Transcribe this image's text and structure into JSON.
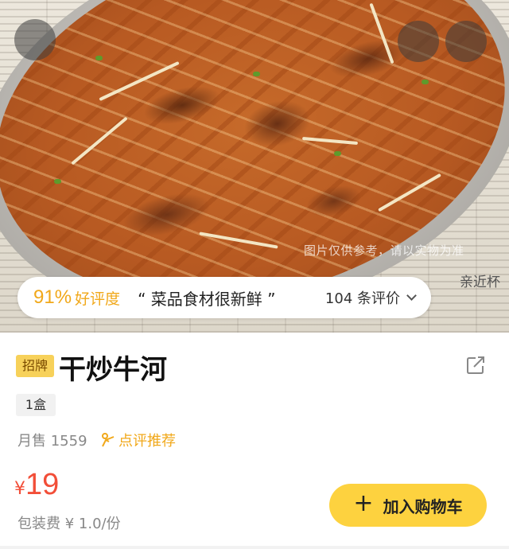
{
  "photo": {
    "watermark": "图片仅供参考，请以实物为准",
    "newspaper_text": "亲近杯"
  },
  "rating": {
    "percent": "91%",
    "label": "好评度",
    "highlight_quote": "“ 菜品食材很新鲜 ”",
    "review_count": "104 条评价"
  },
  "dish": {
    "badge": "招牌",
    "name": "干炒牛河",
    "spec": "1盒",
    "monthly_sales": "月售 1559",
    "recommend": "点评推荐",
    "price_symbol": "¥",
    "price": "19",
    "packaging_fee": "包装费 ¥ 1.0/份"
  },
  "actions": {
    "add_to_cart": "加入购物车"
  },
  "colors": {
    "accent": "#f1a81a",
    "price": "#f24e38",
    "button": "#fdd23f"
  },
  "icons": [
    "share-icon",
    "chevron-down-icon",
    "recommend-icon",
    "plus-icon"
  ]
}
